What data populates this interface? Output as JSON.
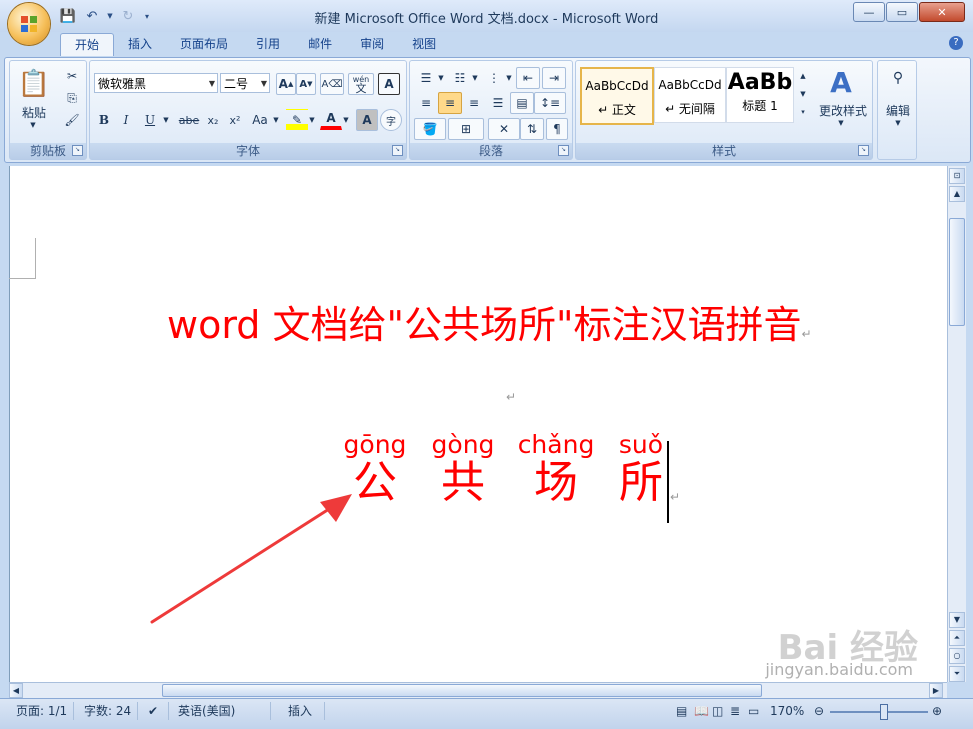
{
  "window": {
    "title": "新建 Microsoft Office Word 文档.docx - Microsoft Word"
  },
  "tabs": [
    "开始",
    "插入",
    "页面布局",
    "引用",
    "邮件",
    "审阅",
    "视图"
  ],
  "ribbon": {
    "clipboard": {
      "label": "剪贴板",
      "paste": "粘贴"
    },
    "font": {
      "label": "字体",
      "font_name": "微软雅黑",
      "font_size": "二号",
      "bold": "B",
      "italic": "I",
      "underline": "U",
      "strike": "abe",
      "sub": "x₂",
      "sup": "x²",
      "change_case": "Aa",
      "font_color": "A",
      "char_shade": "A",
      "wen": "wén",
      "wen_char": "文",
      "grow": "A",
      "shrink": "A",
      "clear": "A",
      "border_char": "A",
      "enclose": "字"
    },
    "paragraph": {
      "label": "段落"
    },
    "styles": {
      "label": "样式",
      "items": [
        {
          "sample": "AaBbCcDd",
          "name": "↵ 正文"
        },
        {
          "sample": "AaBbCcDd",
          "name": "↵ 无间隔"
        },
        {
          "sample": "AaBb",
          "name": "标题 1"
        }
      ],
      "change_styles": "更改样式"
    },
    "editing": {
      "label": "编辑"
    }
  },
  "document": {
    "heading": "word 文档给\"公共场所\"标注汉语拼音",
    "ruby": [
      {
        "pinyin": "gōng",
        "hanzi": "公"
      },
      {
        "pinyin": "gòng",
        "hanzi": "共"
      },
      {
        "pinyin": "chǎng",
        "hanzi": "场"
      },
      {
        "pinyin": "suǒ",
        "hanzi": "所"
      }
    ],
    "para_mark": "↵"
  },
  "statusbar": {
    "page": "页面: 1/1",
    "words": "字数: 24",
    "language": "英语(美国)",
    "insert": "插入",
    "zoom": "170%"
  },
  "watermark": {
    "text": "Bai 经验",
    "url": "jingyan.baidu.com"
  }
}
